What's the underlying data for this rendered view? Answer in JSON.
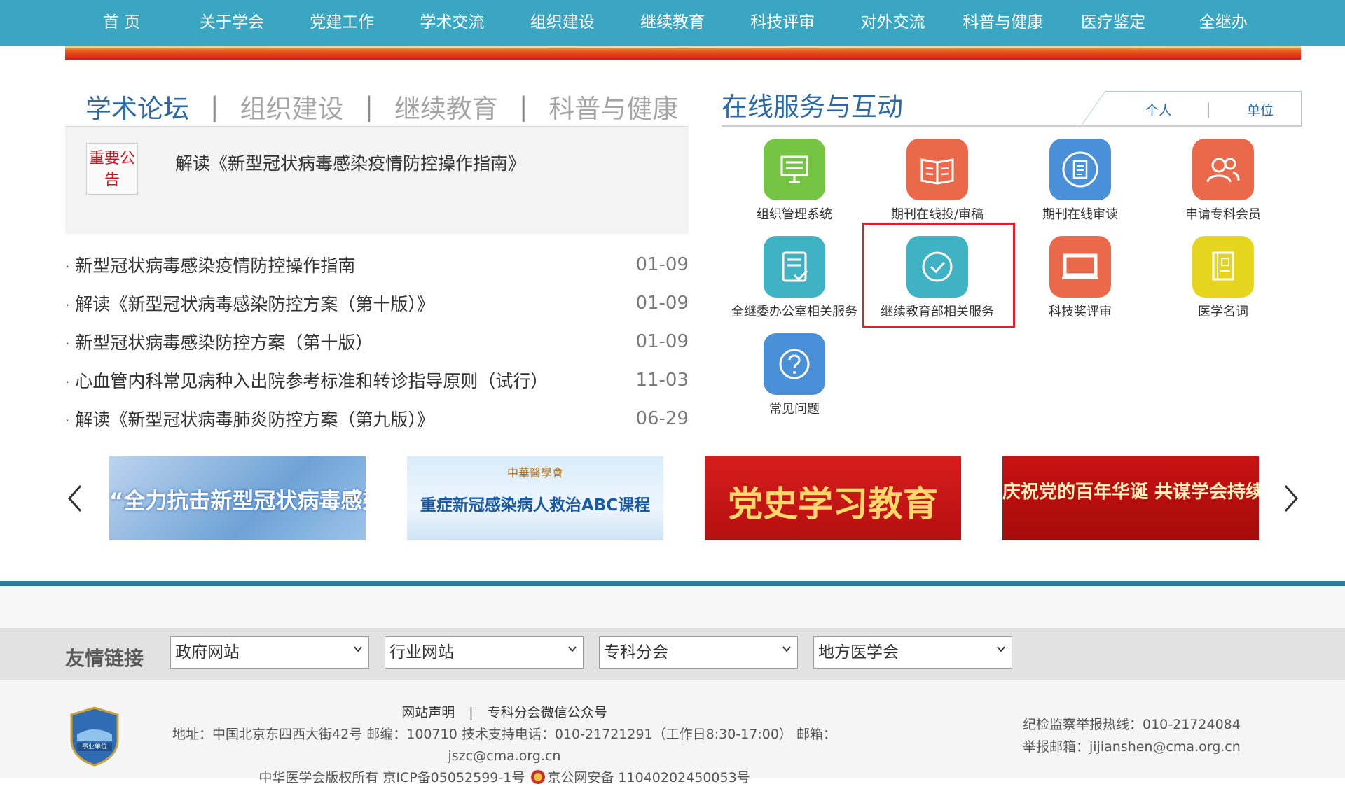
{
  "nav": {
    "items": [
      "首 页",
      "关于学会",
      "党建工作",
      "学术交流",
      "组织建设",
      "继续教育",
      "科技评审",
      "对外交流",
      "科普与健康",
      "医疗鉴定",
      "全继办"
    ]
  },
  "news": {
    "tabs": [
      "学术论坛",
      "组织建设",
      "继续教育",
      "科普与健康"
    ],
    "notice_badge": "重要公告",
    "notice_title": "解读《新型冠状病毒感染疫情防控操作指南》",
    "items": [
      {
        "title": "新型冠状病毒感染疫情防控操作指南",
        "date": "01-09"
      },
      {
        "title": "解读《新型冠状病毒感染防控方案（第十版）》",
        "date": "01-09"
      },
      {
        "title": "新型冠状病毒感染防控方案（第十版）",
        "date": "01-09"
      },
      {
        "title": "心血管内科常见病种入出院参考标准和转诊指导原则（试行）",
        "date": "11-03"
      },
      {
        "title": "解读《新型冠状病毒肺炎防控方案（第九版）》",
        "date": "06-29"
      }
    ]
  },
  "services": {
    "title": "在线服务与互动",
    "tab_personal": "个人",
    "tab_unit": "单位",
    "items": [
      {
        "label": "组织管理系统",
        "icon": "presentation-board-icon",
        "color": "#76c443"
      },
      {
        "label": "期刊在线投/审稿",
        "icon": "open-book-icon",
        "color": "#e9694a"
      },
      {
        "label": "期刊在线审读",
        "icon": "document-circle-icon",
        "color": "#4a90d9"
      },
      {
        "label": "申请专科会员",
        "icon": "users-icon",
        "color": "#e9694a"
      },
      {
        "label": "全继委办公室相关服务",
        "icon": "clipboard-check-icon",
        "color": "#3fb3c3"
      },
      {
        "label": "继续教育部相关服务",
        "icon": "check-circle-icon",
        "color": "#3fb3c3"
      },
      {
        "label": "科技奖评审",
        "icon": "monitor-icon",
        "color": "#e9694a"
      },
      {
        "label": "医学名词",
        "icon": "dictionary-icon",
        "color": "#e6d51f"
      },
      {
        "label": "常见问题",
        "icon": "question-circle-icon",
        "color": "#4a90d9"
      }
    ]
  },
  "carousel": {
    "slides": [
      {
        "text": "“全力抗击新型冠状病毒感染疫情”",
        "top_text": ""
      },
      {
        "text": "重症新冠感染病人救治ABC课程",
        "top_text": "中華醫學會"
      },
      {
        "text": "党史学习教育",
        "top_text": ""
      },
      {
        "text": "庆祝党的百年华诞 共谋学会持续发展",
        "top_text": ""
      }
    ]
  },
  "friend_links": {
    "title": "友情链接",
    "selects": [
      "政府网站",
      "行业网站",
      "专科分会",
      "地方医学会"
    ]
  },
  "footer": {
    "emblem_text": "事业单位",
    "link_statement": "网站声明",
    "link_separator": "|",
    "link_wechat": "专科分会微信公众号",
    "address": "地址：中国北京东四西大街42号 邮编：100710 技术支持电话：010-21721291（工作日8:30-17:00） 邮箱：jszc@cma.org.cn",
    "copyright": "中华医学会版权所有 京ICP备05052599-1号",
    "police": "京公网安备 11040202450053号",
    "hotline": "纪检监察举报热线：010-21724084",
    "report_email": "举报邮箱：jijianshen@cma.org.cn"
  }
}
